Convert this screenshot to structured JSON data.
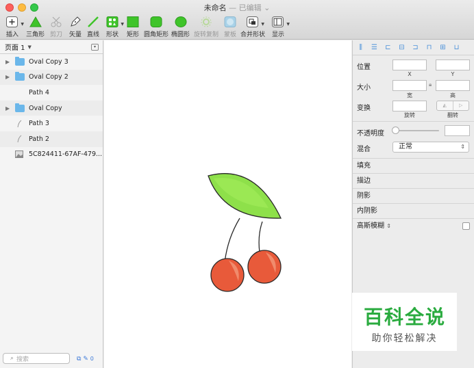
{
  "window": {
    "title": "未命名",
    "subtitle": "— 已编辑",
    "subtitle_chevron": "⌄"
  },
  "toolbar": {
    "insert": "插入",
    "triangle": "三角形",
    "scissors": "剪刀",
    "vector": "矢量",
    "line": "直线",
    "shape": "形状",
    "rectangle": "矩形",
    "rounded_rect": "圆角矩形",
    "oval": "椭圆形",
    "rotate_copy": "旋转复制",
    "mask": "蒙板",
    "combine": "合并形状",
    "view": "显示"
  },
  "left": {
    "page": "页面 1",
    "layers": [
      {
        "name": "Oval Copy 3",
        "type": "folder",
        "expandable": true
      },
      {
        "name": "Oval Copy 2",
        "type": "folder",
        "expandable": true
      },
      {
        "name": "Path 4",
        "type": "none",
        "expandable": false
      },
      {
        "name": "Oval Copy",
        "type": "folder",
        "expandable": true
      },
      {
        "name": "Path 3",
        "type": "path",
        "expandable": false
      },
      {
        "name": "Path 2",
        "type": "path",
        "expandable": false
      },
      {
        "name": "5C824411-67AF-479...",
        "type": "image",
        "expandable": false
      }
    ],
    "search_placeholder": "搜索",
    "filter_count": "0"
  },
  "inspector": {
    "position": "位置",
    "x": "X",
    "y": "Y",
    "size": "大小",
    "width": "宽",
    "height": "高",
    "transform": "变换",
    "rotate": "旋转",
    "flip": "翻转",
    "opacity": "不透明度",
    "blend": "混合",
    "blend_value": "正常",
    "fill": "填充",
    "border": "描边",
    "shadow": "阴影",
    "inner_shadow": "内阴影",
    "blur": "高斯模糊"
  },
  "watermark": {
    "big": "百科全说",
    "small": "助你轻松解决"
  },
  "colors": {
    "leaf": "#8ee04a",
    "cherry": "#e85a3a",
    "accent": "#4a90d9",
    "watermark": "#2aab3f"
  }
}
